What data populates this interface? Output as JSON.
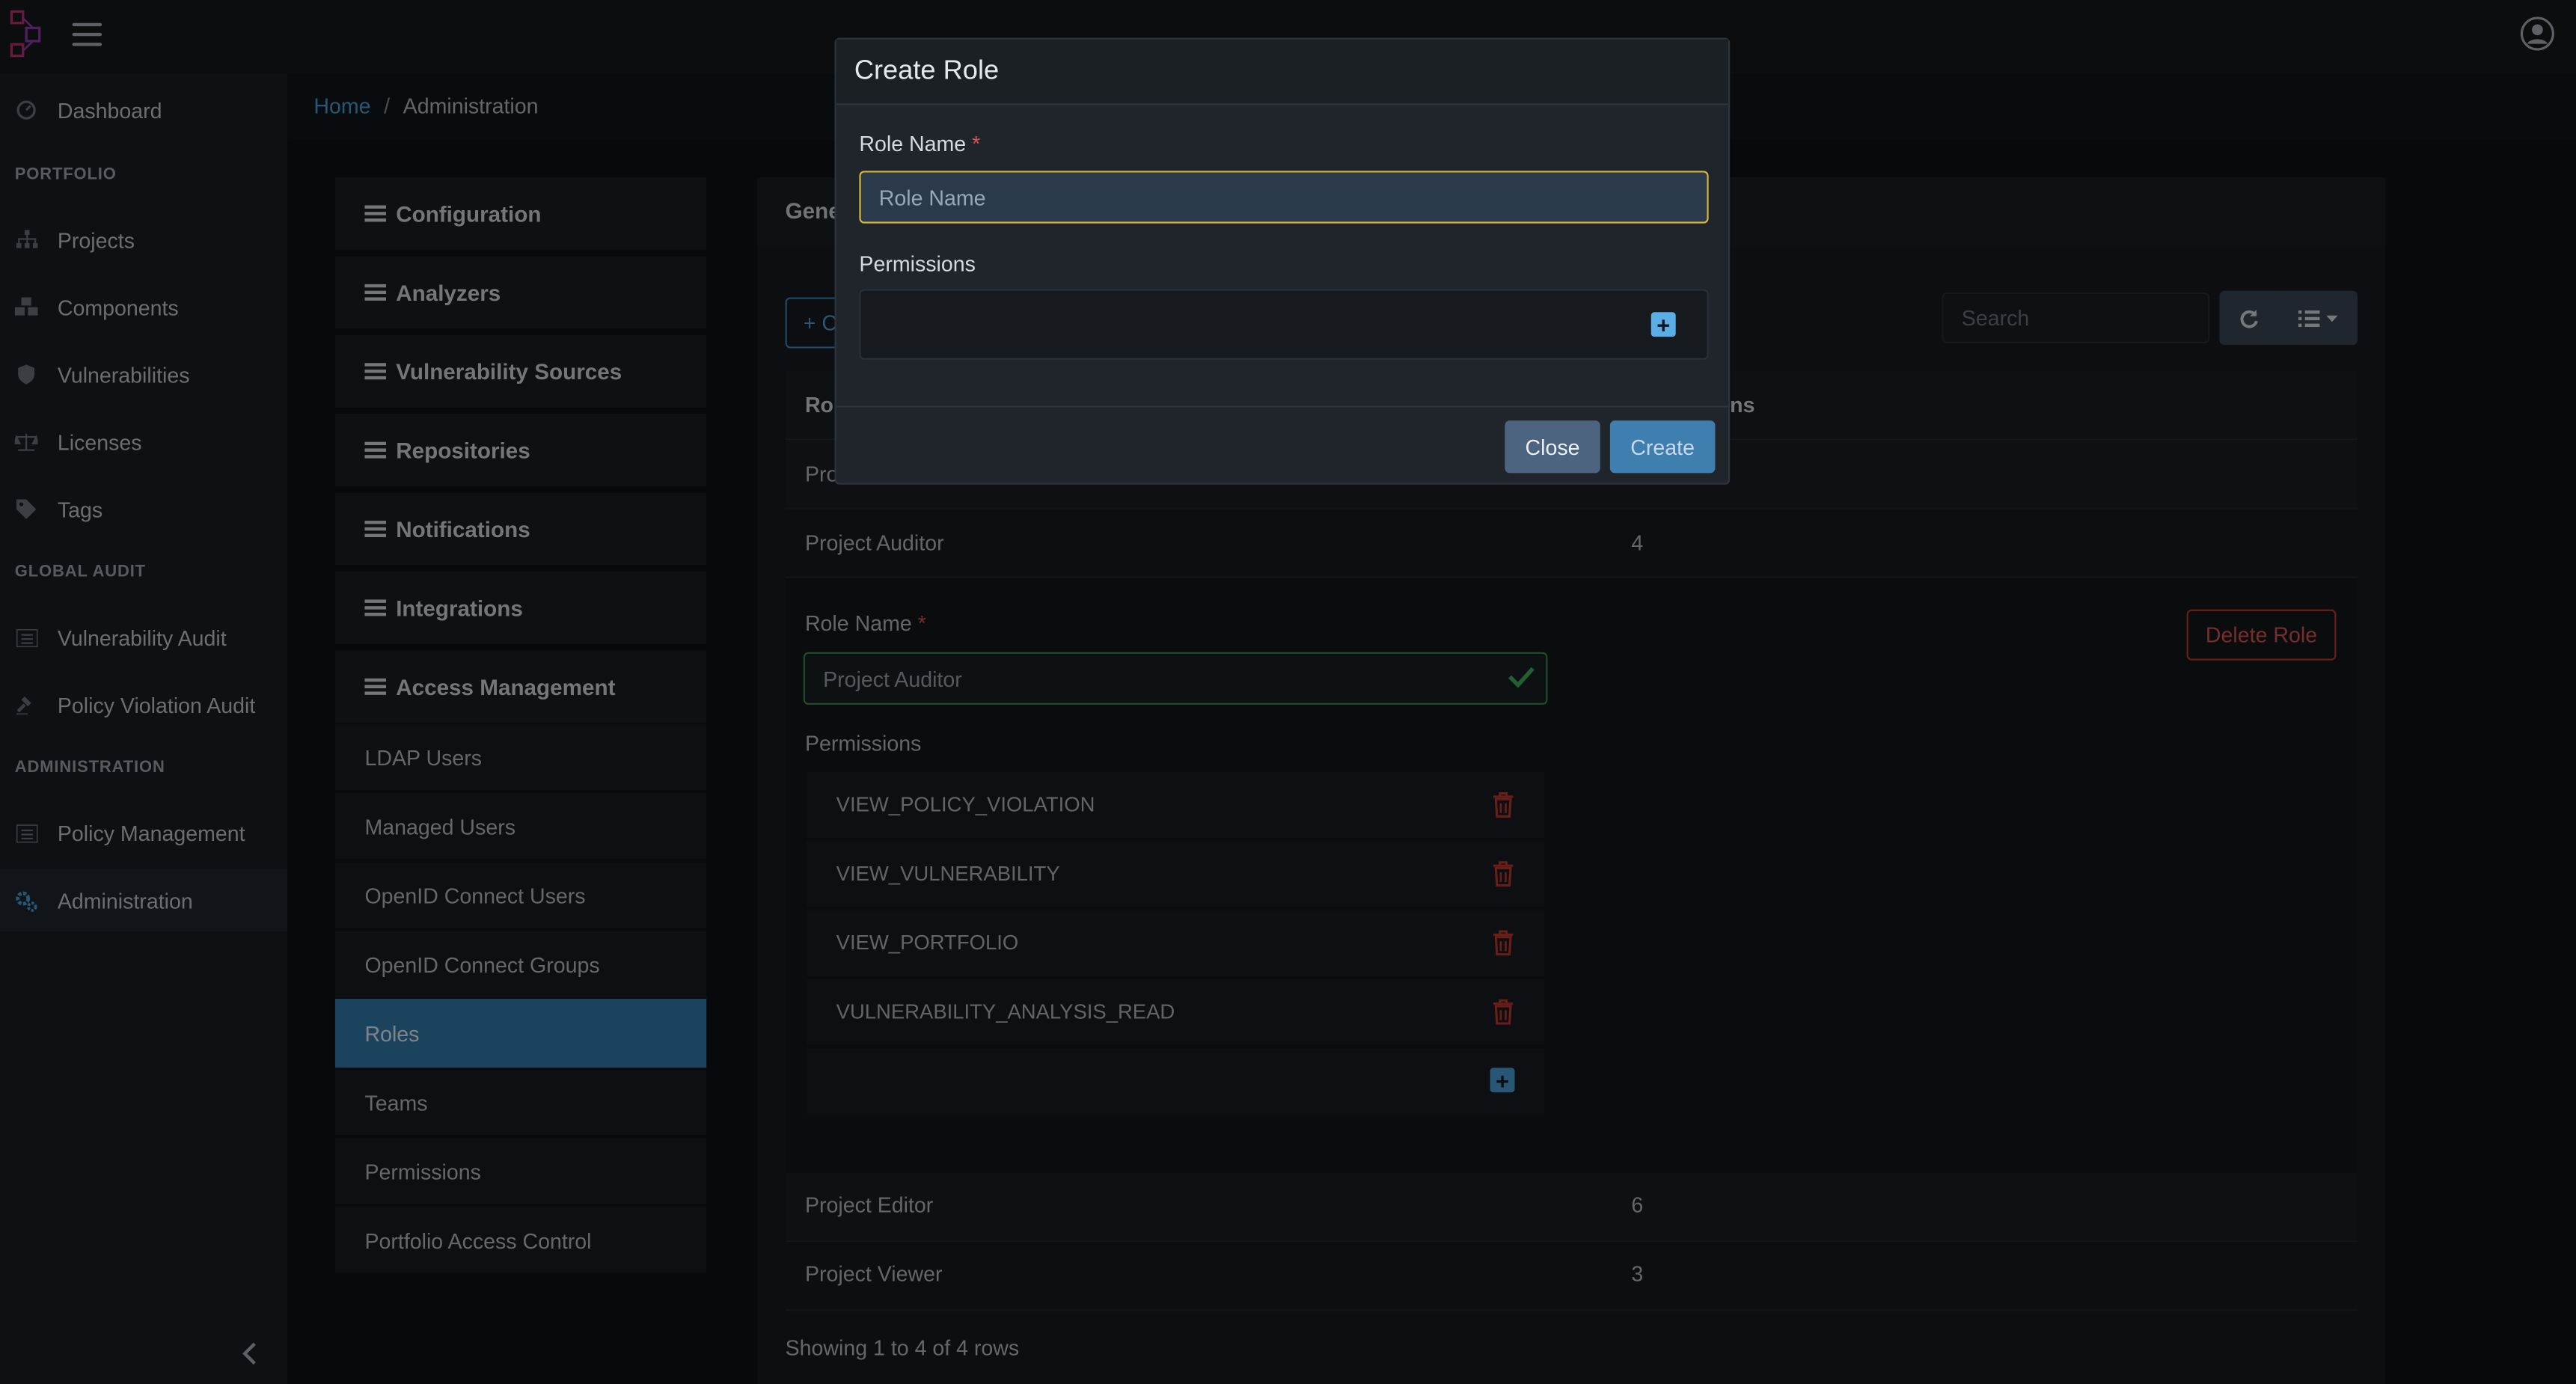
{
  "topbar": {
    "logo_icon": "logo-icon",
    "menu_icon": "hamburger-icon",
    "user_icon": "user-avatar-icon"
  },
  "sidebar": {
    "dashboard": "Dashboard",
    "portfolio_heading": "PORTFOLIO",
    "projects": "Projects",
    "components": "Components",
    "vulnerabilities": "Vulnerabilities",
    "licenses": "Licenses",
    "tags": "Tags",
    "global_audit_heading": "GLOBAL AUDIT",
    "vulnerability_audit": "Vulnerability Audit",
    "policy_violation_audit": "Policy Violation Audit",
    "administration_heading": "ADMINISTRATION",
    "policy_management": "Policy Management",
    "administration": "Administration"
  },
  "breadcrumb": {
    "home": "Home",
    "separator": "/",
    "current": "Administration"
  },
  "subnav": {
    "configuration": "Configuration",
    "analyzers": "Analyzers",
    "vulnerability_sources": "Vulnerability Sources",
    "repositories": "Repositories",
    "notifications": "Notifications",
    "integrations": "Integrations",
    "access_management": "Access Management",
    "items": [
      "LDAP Users",
      "Managed Users",
      "OpenID Connect Users",
      "OpenID Connect Groups",
      "Roles",
      "Teams",
      "Permissions",
      "Portfolio Access Control"
    ]
  },
  "card": {
    "title_partial": "Gene",
    "create_partial": "+ C",
    "search_placeholder": "Search",
    "col_role_partial": "Rol",
    "col_permissions_partial": "ns",
    "row1_partial": "Pro",
    "rows": [
      {
        "name": "Project Auditor",
        "count": "4"
      },
      {
        "name": "Project Editor",
        "count": "6"
      },
      {
        "name": "Project Viewer",
        "count": "3"
      }
    ],
    "detail": {
      "role_name_label": "Role Name",
      "required": "*",
      "role_name_value": "Project Auditor",
      "delete_role": "Delete Role",
      "permissions_label": "Permissions",
      "permissions": [
        "VIEW_POLICY_VIOLATION",
        "VIEW_VULNERABILITY",
        "VIEW_PORTFOLIO",
        "VULNERABILITY_ANALYSIS_READ"
      ]
    },
    "footer": "Showing 1 to 4 of 4 rows"
  },
  "modal": {
    "title": "Create Role",
    "role_name_label": "Role Name",
    "required": "*",
    "role_name_placeholder": "Role Name",
    "permissions_label": "Permissions",
    "add_symbol": "+",
    "close": "Close",
    "create": "Create"
  },
  "colors": {
    "accent": "#3f7fb0",
    "active_nav": "#347bab",
    "danger": "#d9534f",
    "success": "#3d8a4c",
    "focus_border": "#d5b73b"
  }
}
